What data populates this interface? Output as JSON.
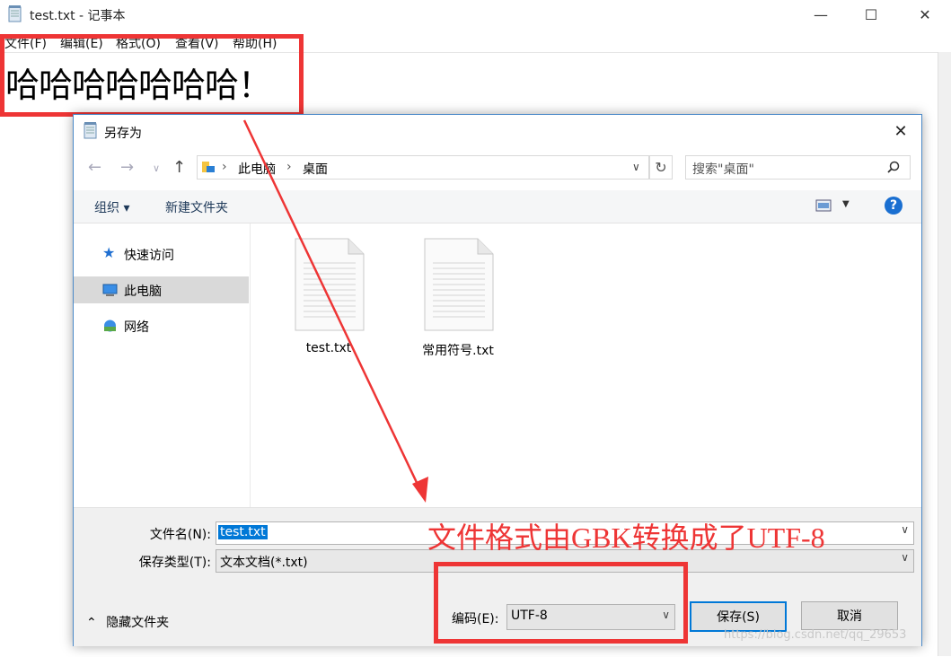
{
  "notepad": {
    "title": "test.txt - 记事本",
    "menu": [
      "文件(F)",
      "编辑(E)",
      "格式(O)",
      "查看(V)",
      "帮助(H)"
    ],
    "content": "哈哈哈哈哈哈哈！"
  },
  "dialog": {
    "title": "另存为",
    "address": [
      "此电脑",
      "桌面"
    ],
    "search_placeholder": "搜索\"桌面\"",
    "toolbar": {
      "organize": "组织 ▾",
      "new_folder": "新建文件夹"
    },
    "nav": [
      "快速访问",
      "此电脑",
      "网络"
    ],
    "files": [
      "test.txt",
      "常用符号.txt"
    ],
    "filename_label": "文件名(N):",
    "filename_value": "test.txt",
    "filetype_label": "保存类型(T):",
    "filetype_value": "文本文档(*.txt)",
    "hide_folders": "隐藏文件夹",
    "encoding_label": "编码(E):",
    "encoding_value": "UTF-8",
    "save": "保存(S)",
    "cancel": "取消"
  },
  "annotation": "文件格式由GBK转换成了UTF-8",
  "watermark": "https://blog.csdn.net/qq_29653",
  "colors": {
    "annotation_red": "#ee3535",
    "accent_blue": "#0078d7"
  }
}
